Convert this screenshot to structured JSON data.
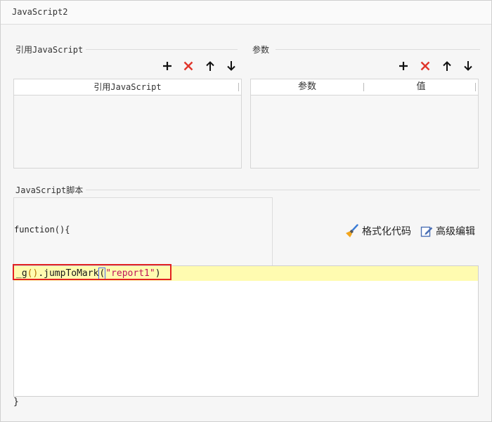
{
  "window": {
    "title": "JavaScript2"
  },
  "references": {
    "section_label": "引用JavaScript",
    "column_header": "引用JavaScript",
    "rows": []
  },
  "parameters": {
    "section_label": "参数",
    "columns": [
      "参数",
      "值"
    ],
    "rows": []
  },
  "toolbar_icons": [
    "add-icon",
    "delete-icon",
    "move-up-icon",
    "move-down-icon"
  ],
  "script": {
    "section_label": "JavaScript脚本",
    "function_header": "function(){",
    "format_code_label": "格式化代码",
    "advanced_edit_label": "高级编辑",
    "code": {
      "prefix": "_g",
      "open_paren": "(",
      "close_paren": ")",
      "member": ".jumpToMark",
      "arg_open": "(",
      "string_arg": "\"report1\"",
      "arg_close": ")"
    },
    "closing": "}"
  },
  "colors": {
    "delete": "#e0352b",
    "highlight_line": "#fffbb0",
    "annotation_box": "#e22222",
    "string": "#c0145a"
  }
}
